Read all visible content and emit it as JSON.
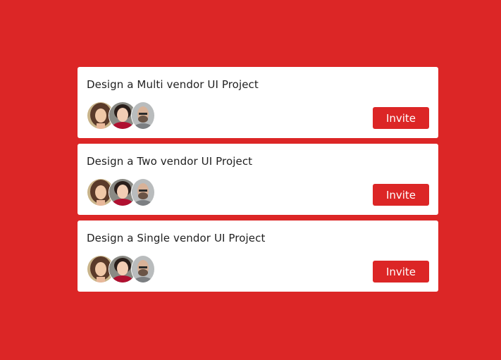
{
  "theme": {
    "background": "#dc2626",
    "card_background": "#ffffff",
    "button_color": "#dc2626",
    "button_text_color": "#ffffff"
  },
  "projects": [
    {
      "title": "Design a Multi vendor UI Project",
      "avatars": [
        "woman-avatar",
        "woman-red-avatar",
        "man-bearded-avatar"
      ],
      "invite_label": "Invite"
    },
    {
      "title": "Design a Two vendor UI Project",
      "avatars": [
        "woman-avatar",
        "woman-red-avatar",
        "man-bearded-avatar"
      ],
      "invite_label": "Invite"
    },
    {
      "title": "Design a Single vendor UI Project",
      "avatars": [
        "woman-avatar",
        "woman-red-avatar",
        "man-bearded-avatar"
      ],
      "invite_label": "Invite"
    }
  ]
}
